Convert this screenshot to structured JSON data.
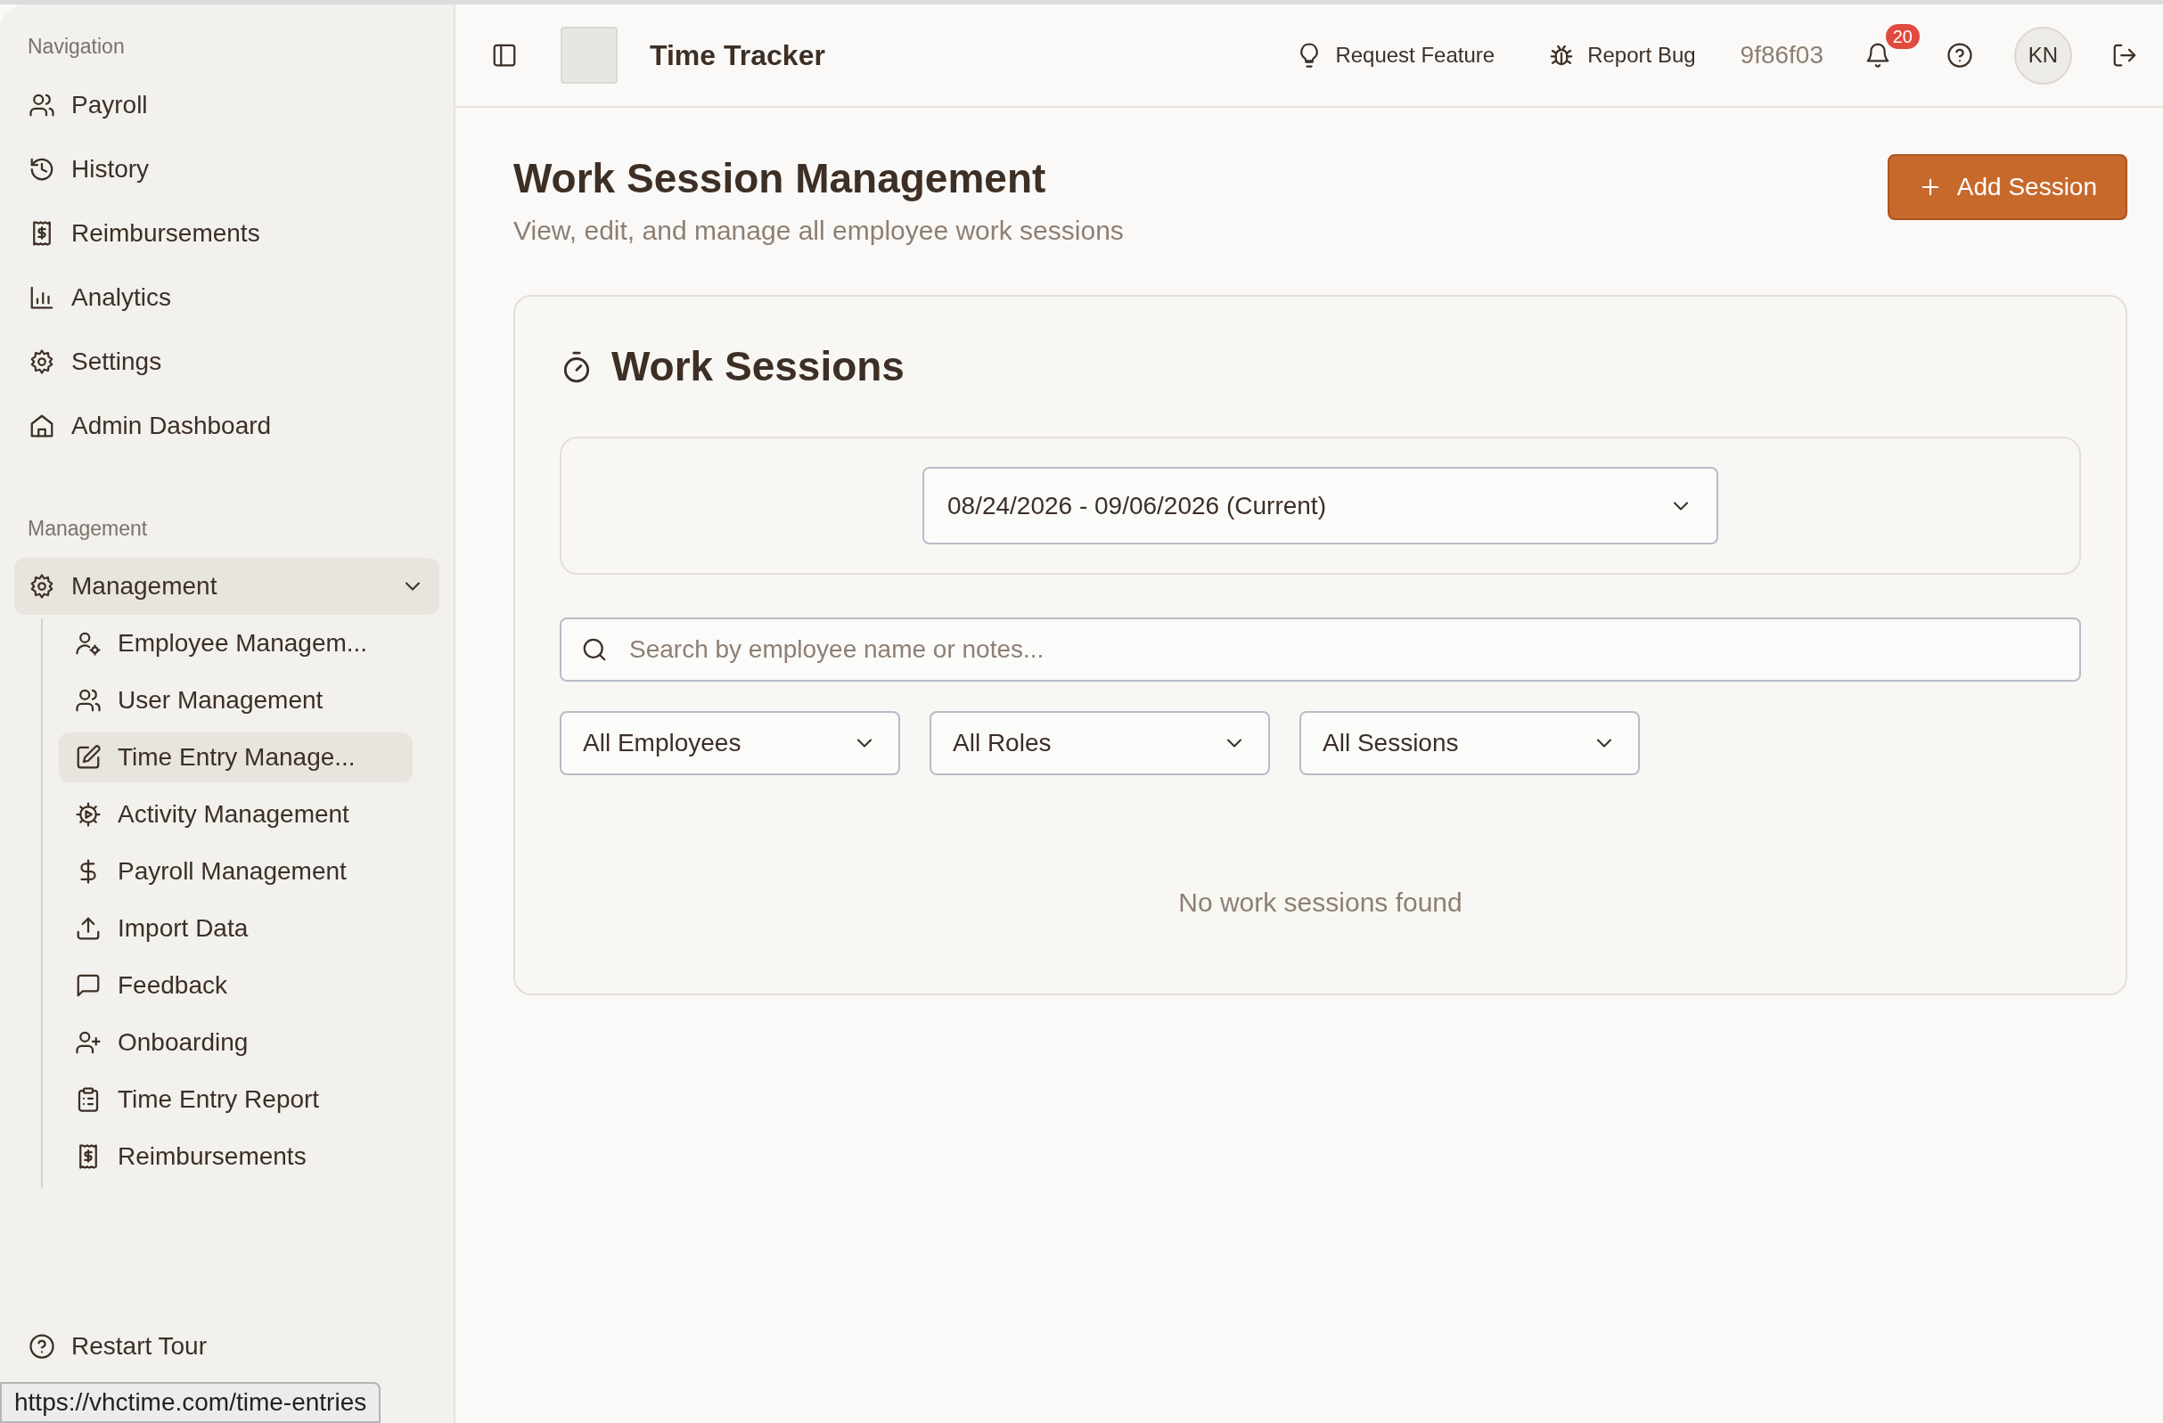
{
  "header": {
    "app_title": "Time Tracker",
    "actions": [
      {
        "label": "Request Feature"
      },
      {
        "label": "Report Bug"
      }
    ],
    "version": "9f86f03",
    "notification_count": "20",
    "avatar_initials": "KN"
  },
  "sidebar": {
    "sections": [
      {
        "title": "Navigation",
        "items": [
          {
            "label": "Payroll",
            "selected": false
          },
          {
            "label": "History",
            "selected": false
          },
          {
            "label": "Reimbursements",
            "selected": false
          },
          {
            "label": "Analytics",
            "selected": false
          },
          {
            "label": "Settings",
            "selected": false
          },
          {
            "label": "Admin Dashboard",
            "selected": false
          }
        ]
      },
      {
        "title": "Management",
        "items": [
          {
            "label": "Management",
            "selected": true,
            "expanded": true,
            "children": [
              {
                "label": "Employee Managem...",
                "selected": false
              },
              {
                "label": "User Management",
                "selected": false
              },
              {
                "label": "Time Entry Manage...",
                "selected": true
              },
              {
                "label": "Activity Management",
                "selected": false
              },
              {
                "label": "Payroll Management",
                "selected": false
              },
              {
                "label": "Import Data",
                "selected": false
              },
              {
                "label": "Feedback",
                "selected": false
              },
              {
                "label": "Onboarding",
                "selected": false
              },
              {
                "label": "Time Entry Report",
                "selected": false
              },
              {
                "label": "Reimbursements",
                "selected": false
              }
            ]
          }
        ]
      }
    ],
    "footer_item": "Restart Tour"
  },
  "page": {
    "title": "Work Session Management",
    "subtitle": "View, edit, and manage all employee work sessions",
    "add_button": "Add Session"
  },
  "card": {
    "title": "Work Sessions",
    "period": "08/24/2026 - 09/06/2026 (Current)",
    "search_placeholder": "Search by employee name or notes...",
    "filters": [
      "All Employees",
      "All Roles",
      "All Sessions"
    ],
    "empty_message": "No work sessions found"
  },
  "status_url": "https://vhctime.com/time-entries"
}
